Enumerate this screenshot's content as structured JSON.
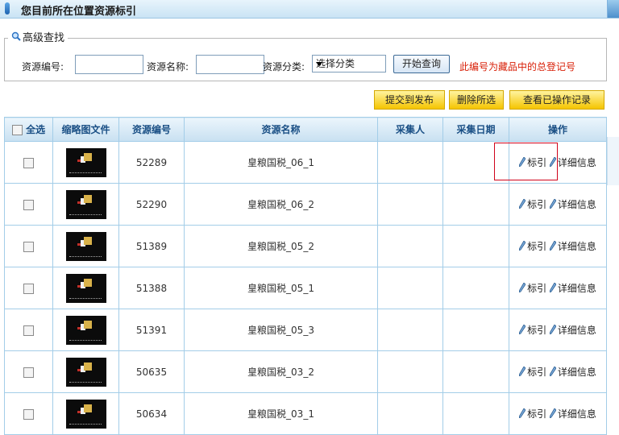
{
  "page": {
    "title": "您目前所在位置资源标引"
  },
  "search": {
    "legend": "高级查找",
    "id_label": "资源编号:",
    "id_value": "",
    "name_label": "资源名称:",
    "name_value": "",
    "category_label": "资源分类:",
    "category_selected": "选择分类",
    "submit_label": "开始查询",
    "note": "此编号为藏品中的总登记号"
  },
  "actions": {
    "publish": "提交到发布",
    "delete_selected": "删除所选",
    "view_log": "查看已操作记录"
  },
  "table": {
    "headers": {
      "select_all": "全选",
      "thumb": "缩略图文件",
      "id": "资源编号",
      "name": "资源名称",
      "collector": "采集人",
      "date": "采集日期",
      "ops": "操作"
    },
    "op_index": "标引",
    "op_detail": "详细信息",
    "rows": [
      {
        "id": "52289",
        "name": "皇粮国税_06_1",
        "collector": "",
        "date": ""
      },
      {
        "id": "52290",
        "name": "皇粮国税_06_2",
        "collector": "",
        "date": ""
      },
      {
        "id": "51389",
        "name": "皇粮国税_05_2",
        "collector": "",
        "date": ""
      },
      {
        "id": "51388",
        "name": "皇粮国税_05_1",
        "collector": "",
        "date": ""
      },
      {
        "id": "51391",
        "name": "皇粮国税_05_3",
        "collector": "",
        "date": ""
      },
      {
        "id": "50635",
        "name": "皇粮国税_03_2",
        "collector": "",
        "date": ""
      },
      {
        "id": "50634",
        "name": "皇粮国税_03_1",
        "collector": "",
        "date": ""
      }
    ]
  },
  "colors": {
    "header_text": "#1a4f85",
    "note_red": "#d81e06",
    "highlight_red": "#d0021b",
    "button_yellow": "#f5c500"
  }
}
